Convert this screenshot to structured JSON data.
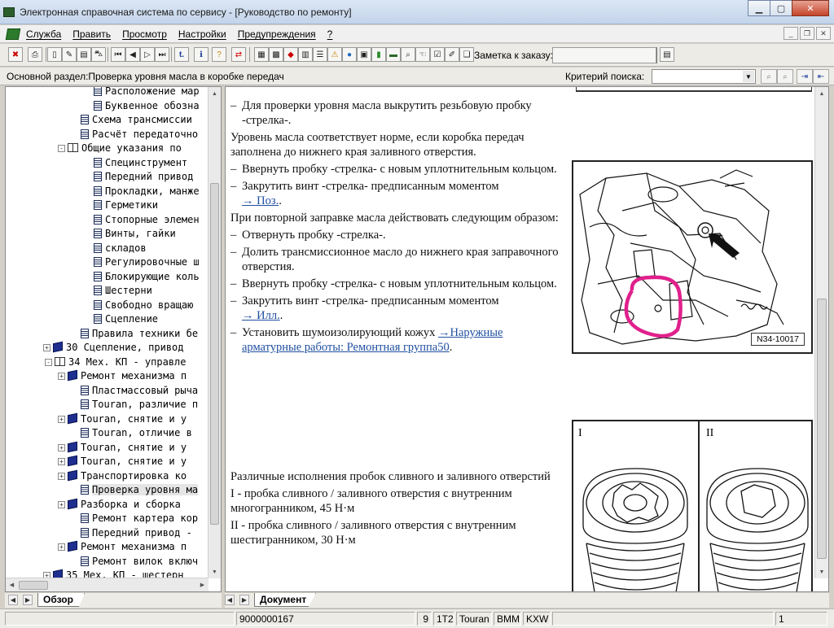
{
  "window": {
    "title": "Электронная справочная система по сервису - [Руководство по ремонту]"
  },
  "menu": {
    "items": [
      "Служба",
      "Править",
      "Просмотр",
      "Настройки",
      "Предупреждения",
      "?"
    ]
  },
  "toolbar": {
    "note_label": "Заметка к заказу:",
    "note_value": ""
  },
  "section_bar": {
    "label": "Основной раздел:Проверка уровня масла в коробке передач",
    "search_label": "Критерий поиска:",
    "search_value": ""
  },
  "tree": {
    "items": [
      {
        "text": "Расположение мар",
        "icon": "doc-icon"
      },
      {
        "text": "Буквенное обозна",
        "icon": "doc-icon"
      },
      {
        "text": "Схема трансмиссии",
        "icon": "doc-icon"
      },
      {
        "text": "Расчёт передаточно",
        "icon": "doc-icon"
      },
      {
        "text": "Общие указания по",
        "icon": "book-open-icon",
        "expander": "-"
      },
      {
        "text": "Специнструмент",
        "icon": "doc-icon"
      },
      {
        "text": "Передний привод",
        "icon": "doc-icon"
      },
      {
        "text": "Прокладки, манже",
        "icon": "doc-icon"
      },
      {
        "text": "Герметики",
        "icon": "doc-icon"
      },
      {
        "text": "Стопорные элемен",
        "icon": "doc-icon"
      },
      {
        "text": "Винты, гайки",
        "icon": "doc-icon"
      },
      {
        "text": "складов",
        "icon": "doc-icon"
      },
      {
        "text": "Регулировочные ш",
        "icon": "doc-icon"
      },
      {
        "text": "Блокирующие коль",
        "icon": "doc-icon"
      },
      {
        "text": "Шестерни",
        "icon": "doc-icon"
      },
      {
        "text": "Свободно вращаю",
        "icon": "doc-icon"
      },
      {
        "text": "Сцепление",
        "icon": "doc-icon"
      },
      {
        "text": "Правила техники бе",
        "icon": "doc-icon"
      },
      {
        "text": "30 Сцепление, привод",
        "icon": "book-icon",
        "expander": "+"
      },
      {
        "text": "34 Мех. КП - управле",
        "icon": "book-open-icon",
        "expander": "-"
      },
      {
        "text": "Ремонт механизма п",
        "icon": "book-icon",
        "expander": "+"
      },
      {
        "text": "Пластмассовый рыча",
        "icon": "doc-icon"
      },
      {
        "text": "Touran, различие п",
        "icon": "doc-icon"
      },
      {
        "text": "Touran, снятие и у",
        "icon": "book-icon",
        "expander": "+"
      },
      {
        "text": "Touran, отличие в",
        "icon": "doc-icon"
      },
      {
        "text": "Touran, снятие и у",
        "icon": "book-icon",
        "expander": "+"
      },
      {
        "text": "Touran, снятие и у",
        "icon": "book-icon",
        "expander": "+"
      },
      {
        "text": "Транспортировка ко",
        "icon": "book-icon",
        "expander": "+"
      },
      {
        "text": "Проверка уровня ма",
        "icon": "doc-icon",
        "selected": true
      },
      {
        "text": "Разборка и сборка",
        "icon": "book-icon",
        "expander": "+"
      },
      {
        "text": "Ремонт картера кор",
        "icon": "doc-icon"
      },
      {
        "text": "Передний привод -",
        "icon": "doc-icon"
      },
      {
        "text": "Ремонт механизма п",
        "icon": "book-icon",
        "expander": "+"
      },
      {
        "text": "Ремонт вилок включ",
        "icon": "doc-icon"
      },
      {
        "text": "35 Мех. КП - шестерн",
        "icon": "book-icon",
        "expander": "+"
      }
    ]
  },
  "tabs": {
    "left_tab": "Обзор",
    "right_tab": "Документ"
  },
  "content": {
    "steps_top": [
      {
        "type": "step",
        "text": "Для проверки уровня масла выкрутить резьбовую пробку -стрелка-."
      },
      {
        "type": "para",
        "text": "Уровень масла соответствует норме, если коробка передач заполнена до нижнего края заливного отверстия."
      },
      {
        "type": "step",
        "text": "Ввернуть пробку -стрелка- с новым уплотнительным кольцом."
      },
      {
        "type": "step",
        "text": "Закрутить винт -стрелка- предписанным моментом",
        "link": "→ Поз."
      },
      {
        "type": "para",
        "text": "При повторной заправке масла действовать следующим образом:"
      },
      {
        "type": "step",
        "text": "Отвернуть пробку -стрелка-."
      },
      {
        "type": "step",
        "text": "Долить трансмиссионное масло до нижнего края заправочного отверстия."
      },
      {
        "type": "step",
        "text": "Ввернуть пробку -стрелка- с новым уплотнительным кольцом."
      },
      {
        "type": "step",
        "text": "Закрутить винт -стрелка- предписанным моментом",
        "link": "→ Илл."
      },
      {
        "type": "step",
        "text": "Установить шумоизолирующий кожух",
        "link": "→Наружные арматурные работы: Ремонтная группа50",
        "after": "."
      }
    ],
    "variants_title": "Различные исполнения пробок сливного и заливного отверстий",
    "variant_1": "I - пробка сливного / заливного отверстия с внутренним многогранником, 45 Н·м",
    "variant_2": "II - пробка сливного / заливного отверстия с внутренним шестигранником, 30 Н·м",
    "figure1_label": "N34-10017",
    "figure2_label_1": "I",
    "figure2_label_2": "II"
  },
  "status": {
    "doc_id": "9000000167",
    "field_1": "9",
    "field_2": "1T2",
    "model": "Touran",
    "engine": "BMM",
    "gearbox": "KXW",
    "page": "1"
  },
  "colors": {
    "link": "#1f4fa0",
    "highlight_circle": "#e0208c",
    "arrow": "#111111"
  }
}
